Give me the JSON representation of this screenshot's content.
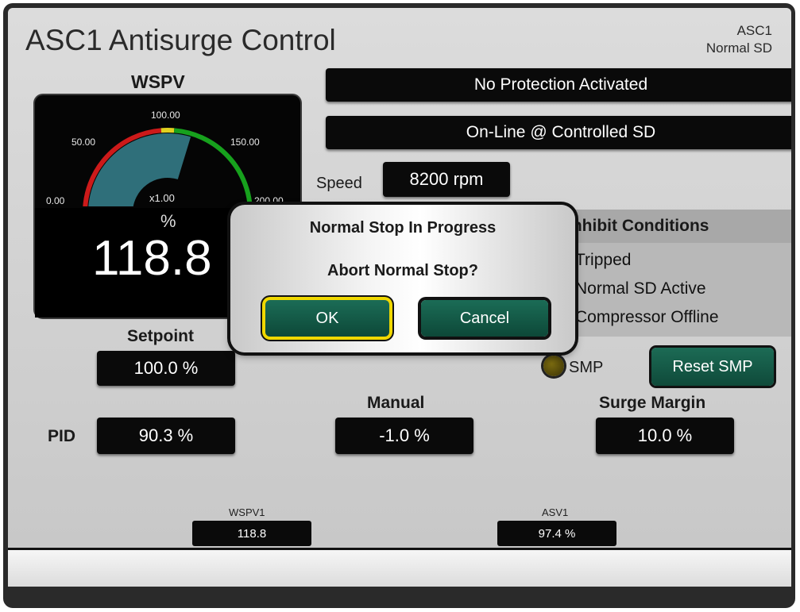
{
  "header": {
    "title": "ASC1 Antisurge Control",
    "unit_name": "ASC1",
    "unit_state": "Normal SD"
  },
  "status_bars": {
    "protection": "No Protection Activated",
    "mode": "On-Line @ Controlled SD"
  },
  "speed": {
    "label": "Speed",
    "value": "8200 rpm"
  },
  "gauge": {
    "title": "WSPV",
    "ticks": {
      "t0": "0.00",
      "t50": "50.00",
      "t100": "100.00",
      "t150": "150.00",
      "t200": "200.00"
    },
    "multiplier": "x1.00",
    "unit": "%",
    "value": "118.8",
    "level": 118.8,
    "range": [
      0,
      200
    ],
    "colors": {
      "low": "#cc1a1a",
      "mid": "#e0d020",
      "high": "#17a11d",
      "fill": "#2f6f7a"
    }
  },
  "inhibit": {
    "header": "Inhibit Conditions",
    "items": [
      "Tripped",
      "Normal SD Active",
      "Compressor Offline"
    ]
  },
  "setpoint": {
    "label": "Setpoint",
    "value": "100.0 %"
  },
  "smp": {
    "label": "SMP",
    "reset_label": "Reset SMP"
  },
  "pid": {
    "label": "PID",
    "value": "90.3 %"
  },
  "manual": {
    "label": "Manual",
    "value": "-1.0 %"
  },
  "surge_margin": {
    "label": "Surge Margin",
    "value": "10.0 %"
  },
  "trends": [
    {
      "label": "WSPV1",
      "value": "118.8"
    },
    {
      "label": "ASV1",
      "value": "97.4 %"
    }
  ],
  "dialog": {
    "title": "Normal Stop In Progress",
    "question": "Abort Normal Stop?",
    "ok_label": "OK",
    "cancel_label": "Cancel"
  },
  "colors": {
    "accent_green": "#0f4a3a",
    "highlight_yellow": "#f0d800"
  }
}
